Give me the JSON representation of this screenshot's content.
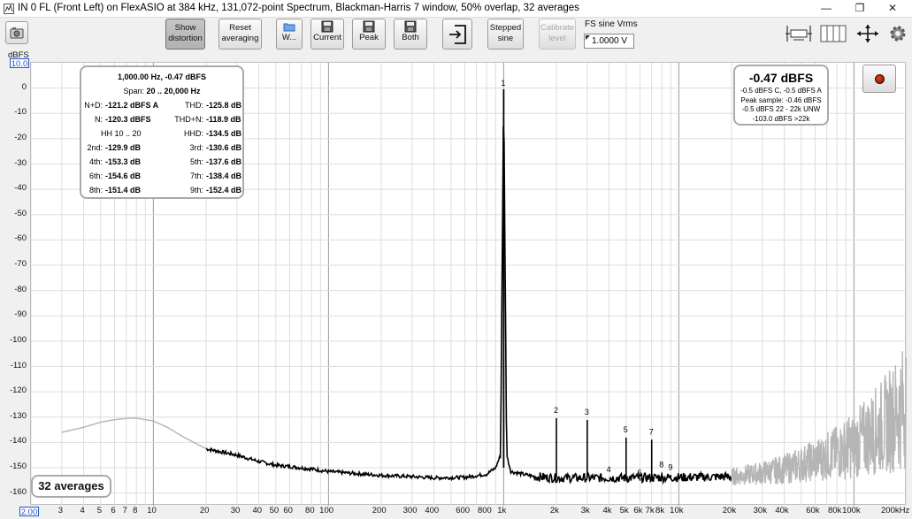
{
  "window": {
    "title": "IN 0 FL (Front Left) on FlexASIO at 384 kHz, 131,072-point Spectrum, Blackman-Harris 7 window, 50% overlap, 32 averages",
    "minimize_glyph": "—",
    "restore_glyph": "❐",
    "close_glyph": "✕"
  },
  "toolbar": {
    "buttons": [
      {
        "id": "show-distortion",
        "line1": "Show",
        "line2": "distortion",
        "pressed": true
      },
      {
        "id": "reset-averaging",
        "line1": "Reset",
        "line2": "averaging"
      },
      {
        "id": "w",
        "line1": "",
        "line2": "W...",
        "icon": "folder-icon"
      },
      {
        "id": "current",
        "line1": "",
        "line2": "Current",
        "icon": "save-icon"
      },
      {
        "id": "peak",
        "line1": "",
        "line2": "Peak",
        "icon": "save-icon"
      },
      {
        "id": "both",
        "line1": "",
        "line2": "Both",
        "icon": "save-icon"
      },
      {
        "id": "export",
        "line1": "",
        "line2": "",
        "icon": "export-icon"
      },
      {
        "id": "stepped-sine",
        "line1": "Stepped",
        "line2": "sine"
      },
      {
        "id": "calibrate-level",
        "line1": "Calibrate",
        "line2": "level",
        "disabled": true
      }
    ],
    "fs_label": "FS sine Vrms",
    "fs_value": "1.0000 V",
    "right_icons": [
      "axis-limits-icon",
      "grid-layout-icon",
      "move-arrows-icon",
      "gear-icon"
    ]
  },
  "axes": {
    "y_unit": "dBFS",
    "y_top_box": "10.0",
    "x_left_box": "2.00",
    "y_ticks": [
      "0",
      "-10",
      "-20",
      "-30",
      "-40",
      "-50",
      "-60",
      "-70",
      "-80",
      "-90",
      "-100",
      "-110",
      "-120",
      "-130",
      "-140",
      "-150",
      "-160"
    ],
    "x_ticks": [
      "3",
      "4",
      "5",
      "6",
      "7",
      "8",
      "10",
      "20",
      "30",
      "40",
      "50",
      "60",
      "80",
      "100",
      "200",
      "300",
      "400",
      "600",
      "800",
      "1k",
      "2k",
      "3k",
      "4k",
      "5k",
      "6k",
      "7k",
      "8k",
      "10k",
      "20k",
      "30k",
      "40k",
      "60k",
      "80k",
      "100k",
      "200kHz"
    ]
  },
  "stats": {
    "header": "1,000.00 Hz, -0.47 dBFS",
    "span_label": "Span:",
    "span_value": "20 .. 20,000 Hz",
    "hh_label": "HH 10 .. 20",
    "rows": [
      {
        "l1": "N+D:",
        "v1": "-121.2 dBFS A",
        "l2": "THD:",
        "v2": "-125.8 dB"
      },
      {
        "l1": "N:",
        "v1": "-120.3 dBFS",
        "l2": "THD+N:",
        "v2": "-118.9 dB"
      },
      {
        "l1": "",
        "v1": "",
        "l2": "HHD:",
        "v2": "-134.5 dB"
      },
      {
        "l1": "2nd:",
        "v1": "-129.9 dB",
        "l2": "3rd:",
        "v2": "-130.6 dB"
      },
      {
        "l1": "4th:",
        "v1": "-153.3 dB",
        "l2": "5th:",
        "v2": "-137.6 dB"
      },
      {
        "l1": "6th:",
        "v1": "-154.6 dB",
        "l2": "7th:",
        "v2": "-138.4 dB"
      },
      {
        "l1": "8th:",
        "v1": "-151.4 dB",
        "l2": "9th:",
        "v2": "-152.4 dB"
      }
    ]
  },
  "level": {
    "main": "-0.47 dBFS",
    "lines": [
      "-0.5 dBFS C, -0.5 dBFS A",
      "Peak sample: -0.46 dBFS",
      "-0.5 dBFS 22 - 22k UNW",
      "-103.0 dBFS >22k"
    ]
  },
  "averages_badge": "32 averages",
  "colors": {
    "trace": "#000000",
    "trace_out_of_band": "#b5b5b5",
    "grid": "#d9d9d9",
    "axis_box": "#2255cc",
    "record": "#c0260c"
  },
  "chart_data": {
    "type": "line",
    "xscale": "log",
    "xlim": [
      2,
      200000
    ],
    "ylim": [
      -165,
      10
    ],
    "ylabel": "dBFS",
    "fundamental": {
      "label": "1",
      "x": 1000,
      "y": -0.47
    },
    "harmonics": [
      {
        "label": "2",
        "x": 2000,
        "y": -130.4
      },
      {
        "label": "3",
        "x": 3000,
        "y": -131.1
      },
      {
        "label": "4",
        "x": 4000,
        "y": -153.8
      },
      {
        "label": "5",
        "x": 5000,
        "y": -138.1
      },
      {
        "label": "6",
        "x": 6000,
        "y": -155.1
      },
      {
        "label": "7",
        "x": 7000,
        "y": -138.9
      },
      {
        "label": "8",
        "x": 8000,
        "y": -151.9
      },
      {
        "label": "9",
        "x": 9000,
        "y": -152.9
      }
    ],
    "series": [
      {
        "name": "in-band",
        "points": [
          [
            20,
            -142.5
          ],
          [
            30,
            -145
          ],
          [
            40,
            -147.5
          ],
          [
            50,
            -149
          ],
          [
            60,
            -149.5
          ],
          [
            80,
            -150.5
          ],
          [
            100,
            -151.5
          ],
          [
            200,
            -153
          ],
          [
            300,
            -153.5
          ],
          [
            400,
            -154
          ],
          [
            600,
            -153.8
          ],
          [
            800,
            -152.5
          ],
          [
            900,
            -150
          ],
          [
            960,
            -145
          ],
          [
            1000,
            -0.47
          ],
          [
            1040,
            -145
          ],
          [
            1100,
            -151.5
          ],
          [
            1500,
            -153.5
          ],
          [
            2000,
            -154
          ],
          [
            5000,
            -154
          ],
          [
            10000,
            -153.8
          ],
          [
            20000,
            -153.5
          ]
        ]
      },
      {
        "name": "out-of-band-low",
        "points": [
          [
            3,
            -136
          ],
          [
            4,
            -134
          ],
          [
            5,
            -132
          ],
          [
            6,
            -131
          ],
          [
            7,
            -130.5
          ],
          [
            8,
            -130.4
          ],
          [
            10,
            -131.5
          ],
          [
            12,
            -134
          ],
          [
            15,
            -138
          ],
          [
            20,
            -142.5
          ]
        ]
      },
      {
        "name": "out-of-band-high",
        "points": [
          [
            20000,
            -153.5
          ],
          [
            30000,
            -152
          ],
          [
            40000,
            -150.5
          ],
          [
            60000,
            -147
          ],
          [
            80000,
            -144
          ],
          [
            100000,
            -141
          ],
          [
            150000,
            -133
          ],
          [
            200000,
            -125
          ]
        ]
      }
    ]
  }
}
